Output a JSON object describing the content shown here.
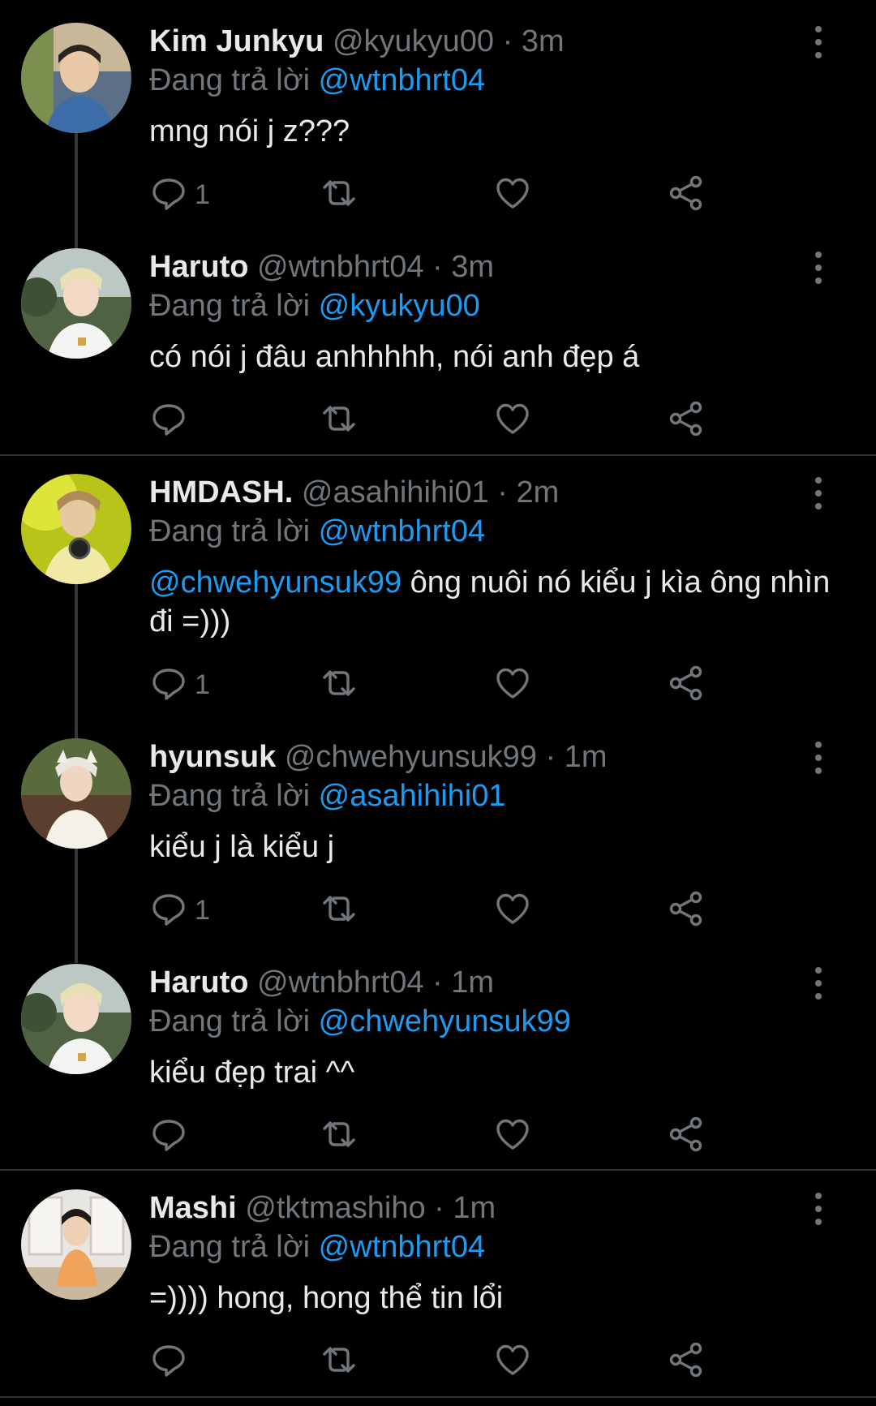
{
  "reply_prefix": "Đang trả lời",
  "colors": {
    "background": "#000000",
    "text": "#e7e9ea",
    "muted": "#71767b",
    "mention": "#1d9bf0",
    "divider": "#2f3336"
  },
  "icons": [
    "reply-icon",
    "retweet-icon",
    "like-icon",
    "share-icon",
    "more-icon"
  ],
  "tweets": [
    {
      "name": "Kim Junkyu",
      "handle": "@kyukyu00",
      "time": "· 3m",
      "reply_to": "@wtnbhrt04",
      "text": "mng nói j z???",
      "reply_count": "1"
    },
    {
      "name": "Haruto",
      "handle": "@wtnbhrt04",
      "time": "· 3m",
      "reply_to": "@kyukyu00",
      "text": "có nói j đâu anhhhhh, nói anh đẹp á",
      "reply_count": ""
    },
    {
      "name": "HMDASH.",
      "handle": "@asahihihi01",
      "time": "· 2m",
      "reply_to": "@wtnbhrt04",
      "text_mention": "@chwehyunsuk99",
      "text": " ông nuôi nó kiểu j kìa ông nhìn đi =)))",
      "reply_count": "1"
    },
    {
      "name": "hyunsuk",
      "handle": "@chwehyunsuk99",
      "time": "· 1m",
      "reply_to": "@asahihihi01",
      "text": "kiểu j là kiểu j",
      "reply_count": "1"
    },
    {
      "name": "Haruto",
      "handle": "@wtnbhrt04",
      "time": "· 1m",
      "reply_to": "@chwehyunsuk99",
      "text": "kiểu đẹp trai ^^",
      "reply_count": ""
    },
    {
      "name": "Mashi",
      "handle": "@tktmashiho",
      "time": "· 1m",
      "reply_to": "@wtnbhrt04",
      "text": "=)))) hong, hong thể tin lổi",
      "reply_count": ""
    }
  ]
}
